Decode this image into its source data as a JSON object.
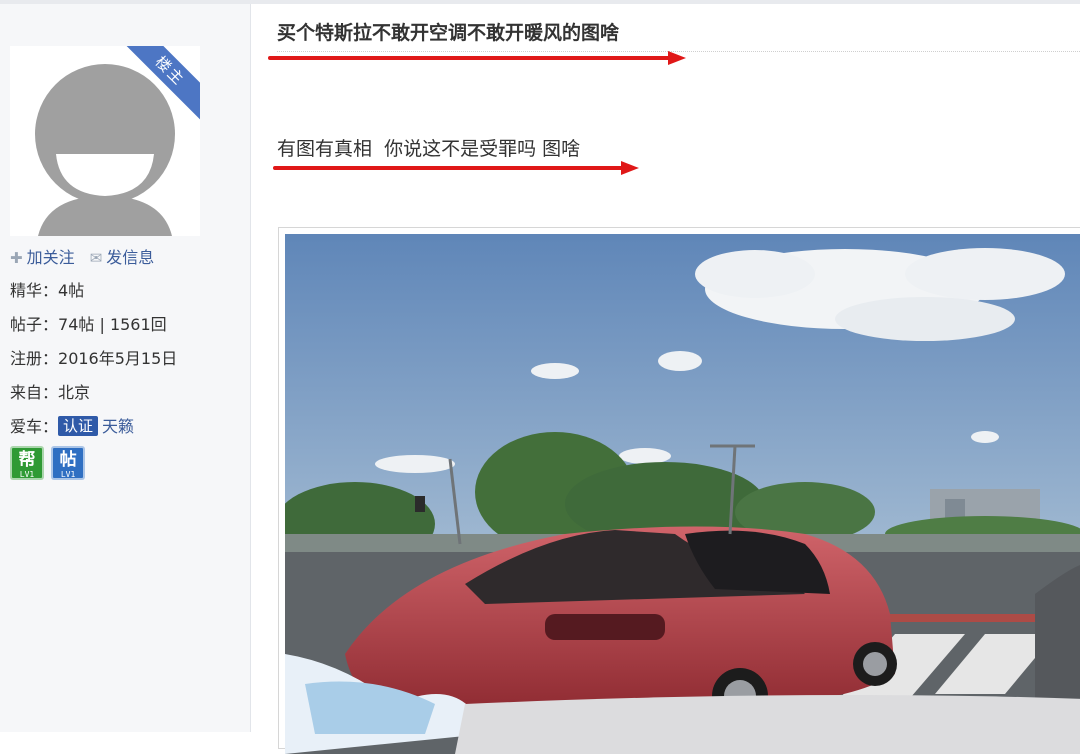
{
  "author": {
    "badge": "楼主",
    "actions": {
      "follow": "加关注",
      "message": "发信息"
    },
    "stats": [
      {
        "label": "精华：",
        "value": "4帖"
      },
      {
        "label": "帖子：",
        "value": "74帖 | 1561回"
      },
      {
        "label": "注册：",
        "value": "2016年5月15日"
      },
      {
        "label": "来自：",
        "value": "北京"
      }
    ],
    "car": {
      "label": "爱车：",
      "cert": "认证",
      "name": "天籁"
    },
    "levels": [
      {
        "glyph": "帮",
        "level": "LV1",
        "color": "#2f9a34"
      },
      {
        "glyph": "帖",
        "level": "LV1",
        "color": "#2f6fc2"
      }
    ]
  },
  "post": {
    "title": "买个特斯拉不敢开空调不敢开暖风的图啥",
    "body": "有图有真相  你说这不是受罪吗 图啥"
  },
  "icons": [
    "plus-icon",
    "mail-icon",
    "red-arrow"
  ],
  "colors": {
    "link": "#3b5c9a",
    "badge": "#4d76c4",
    "annotation": "#e01818"
  }
}
